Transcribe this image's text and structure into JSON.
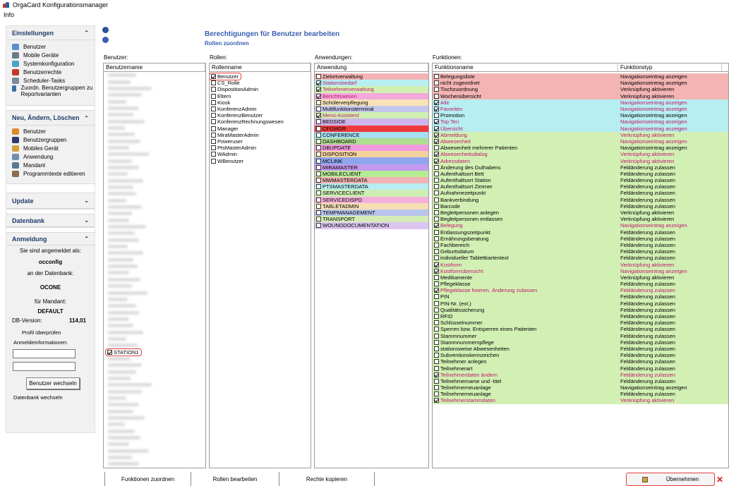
{
  "window": {
    "title": "OrgaCard Konfigurationsmanager",
    "menu": [
      "Info"
    ]
  },
  "sidebar": {
    "einstellungen": {
      "title": "Einstellungen",
      "items": [
        "Benutzer",
        "Mobile Geräte",
        "Systemkonfiguration",
        "Benutzerrechte",
        "Scheduler-Tasks",
        "Zuordn. Benutzergruppen zu Reportvarianten"
      ]
    },
    "neu": {
      "title": "Neu, Ändern, Löschen",
      "items": [
        "Benutzer",
        "Benutzergruppen",
        "Mobiles Gerät",
        "Anwendung",
        "Mandant",
        "Programmtexte editieren"
      ]
    },
    "update": {
      "title": "Update"
    },
    "datenbank": {
      "title": "Datenbank"
    },
    "anmeldung": {
      "title": "Anmeldung",
      "logged_in_as_label": "Sie sind angemeldet als:",
      "user": "occonfig",
      "db_label": "an der Datenbank:",
      "db": "OCONE",
      "mandant_label": "für Mandant:",
      "mandant": "DEFAULT",
      "dbversion_label": "DB-Version:",
      "dbversion": "114,01",
      "profile_check": "Profil überprüfen",
      "login_info_label": "Anmeldeinformationen:",
      "switch_user_btn": "Benutzer wechseln",
      "switch_db": "Datenbank wechseln"
    }
  },
  "main": {
    "heading": "Berechtigungen für Benutzer bearbeiten",
    "subheading": "Rollen zuordnen",
    "users": {
      "label": "Benutzer:",
      "header": "Benutzername",
      "selected": "STATION1"
    },
    "roles": {
      "label": "Rollen:",
      "header": "Rollenname",
      "items": [
        {
          "name": "Benutzer",
          "checked": true
        },
        {
          "name": "CS_Rolle",
          "checked": false
        },
        {
          "name": "DispositionAdmin",
          "checked": false
        },
        {
          "name": "Eltern",
          "checked": false
        },
        {
          "name": "Kiosk",
          "checked": false
        },
        {
          "name": "KonferenzAdmin",
          "checked": false
        },
        {
          "name": "KonferenzBenutzer",
          "checked": false
        },
        {
          "name": "KonferenzRechnungswesen",
          "checked": false
        },
        {
          "name": "Manager",
          "checked": false
        },
        {
          "name": "MiraMasterAdmin",
          "checked": false
        },
        {
          "name": "Poweruser",
          "checked": false
        },
        {
          "name": "PtsMasterAdmin",
          "checked": false
        },
        {
          "name": "WAdmin",
          "checked": false
        },
        {
          "name": "WBenutzer",
          "checked": false
        }
      ]
    },
    "apps": {
      "label": "Anwendungen:",
      "header": "Anwendung",
      "items": [
        {
          "name": "Zielortverwaltung",
          "checked": false,
          "color": "#f4b4b4",
          "text": "#000000"
        },
        {
          "name": "Stationsbedarf",
          "checked": true,
          "color": "#b6eef2",
          "text": "#c0186a"
        },
        {
          "name": "Teilnehmerverwaltung",
          "checked": true,
          "color": "#d2f0b4",
          "text": "#c0186a"
        },
        {
          "name": "Berichtswesen",
          "checked": true,
          "color": "#f5a8dc",
          "text": "#c0186a"
        },
        {
          "name": "Schülerverpflegung",
          "checked": false,
          "color": "#f8e3b8",
          "text": "#000000"
        },
        {
          "name": "Multifunktionsterminal",
          "checked": false,
          "color": "#c3c8ec",
          "text": "#000000"
        },
        {
          "name": "Menü-Assistent",
          "checked": true,
          "color": "#cfeeb0",
          "text": "#c0186a"
        },
        {
          "name": "BEDSIDE",
          "checked": false,
          "color": "#d0b4ec",
          "text": "#000000"
        },
        {
          "name": "CFGMGR",
          "checked": false,
          "color": "#ee3a3a",
          "text": "#000000"
        },
        {
          "name": "CONFERENCE",
          "checked": false,
          "color": "#a6dff0",
          "text": "#000000"
        },
        {
          "name": "DASHBOARD",
          "checked": false,
          "color": "#aedc90",
          "text": "#000000"
        },
        {
          "name": "DBUPDATE",
          "checked": false,
          "color": "#f09be0",
          "text": "#000000"
        },
        {
          "name": "DISPOSITION",
          "checked": false,
          "color": "#f3d39c",
          "text": "#000000"
        },
        {
          "name": "MCLINK",
          "checked": false,
          "color": "#8fa6ee",
          "text": "#000000"
        },
        {
          "name": "MIRAMASTER",
          "checked": false,
          "color": "#c39aee",
          "text": "#000000"
        },
        {
          "name": "MOBILECLIENT",
          "checked": false,
          "color": "#b6ec94",
          "text": "#000000"
        },
        {
          "name": "MWMASTERDATA",
          "checked": false,
          "color": "#f1b3b3",
          "text": "#000000"
        },
        {
          "name": "PTSMASTERDATA",
          "checked": false,
          "color": "#b9edf1",
          "text": "#000000"
        },
        {
          "name": "SERVICECLIENT",
          "checked": false,
          "color": "#cdeeb2",
          "text": "#000000"
        },
        {
          "name": "SERVICEDISPO",
          "checked": false,
          "color": "#f5b0dc",
          "text": "#000000"
        },
        {
          "name": "TABLETADMIN",
          "checked": false,
          "color": "#f7dfb4",
          "text": "#000000"
        },
        {
          "name": "TEMPMANAGEMENT",
          "checked": false,
          "color": "#b9c4ee",
          "text": "#000000"
        },
        {
          "name": "TRANSPORT",
          "checked": false,
          "color": "#d3ecb6",
          "text": "#000000"
        },
        {
          "name": "WOUNDDOCUMENTATION",
          "checked": false,
          "color": "#dcc6f0",
          "text": "#000000"
        }
      ]
    },
    "functions": {
      "label": "Funktionen:",
      "headers": [
        "Funktionsname",
        "Funktionstyp"
      ],
      "items": [
        {
          "name": "Belegungsliste",
          "type": "Navigationseintrag anzeigen",
          "checked": false,
          "color": "#f4b4b4",
          "text": "#000000"
        },
        {
          "name": "nicht zugeordnet",
          "type": "Navigationseintrag anzeigen",
          "checked": false,
          "color": "#f4b4b4",
          "text": "#000000"
        },
        {
          "name": "Tischzuordnung",
          "type": "Verknüpfung aktivieren",
          "checked": false,
          "color": "#f4b4b4",
          "text": "#000000"
        },
        {
          "name": "Wochenübersicht",
          "type": "Verknüpfung aktivieren",
          "checked": false,
          "color": "#f4b4b4",
          "text": "#000000"
        },
        {
          "name": "Alle",
          "type": "Navigationseintrag anzeigen",
          "checked": true,
          "color": "#b6eef2",
          "text": "#c0186a"
        },
        {
          "name": "Favoriten",
          "type": "Navigationseintrag anzeigen",
          "checked": true,
          "color": "#b6eef2",
          "text": "#c0186a"
        },
        {
          "name": "Promotion",
          "type": "Navigationseintrag anzeigen",
          "checked": false,
          "color": "#b6eef2",
          "text": "#000000"
        },
        {
          "name": "Top Ten",
          "type": "Navigationseintrag anzeigen",
          "checked": true,
          "color": "#b6eef2",
          "text": "#c0186a"
        },
        {
          "name": "Übersicht",
          "type": "Navigationseintrag anzeigen",
          "checked": true,
          "color": "#b6eef2",
          "text": "#c0186a"
        },
        {
          "name": "Abmeldung",
          "type": "Verknüpfung aktivieren",
          "checked": true,
          "color": "#d2f0b4",
          "text": "#c0186a"
        },
        {
          "name": "Abwesenheit",
          "type": "Navigationseintrag anzeigen",
          "checked": true,
          "color": "#d2f0b4",
          "text": "#c0186a"
        },
        {
          "name": "Abwesenheit mehrerer Patienten",
          "type": "Navigationseintrag anzeigen",
          "checked": false,
          "color": "#d2f0b4",
          "text": "#000000"
        },
        {
          "name": "Abwesenheitsdialog",
          "type": "Verknüpfung aktivieren",
          "checked": true,
          "color": "#d2f0b4",
          "text": "#c0186a"
        },
        {
          "name": "Adressdaten",
          "type": "Verknüpfung aktivieren",
          "checked": true,
          "color": "#d2f0b4",
          "text": "#c0186a"
        },
        {
          "name": "Änderung des Guthabens",
          "type": "Feldänderung zulassen",
          "checked": false,
          "color": "#d2f0b4",
          "text": "#000000"
        },
        {
          "name": "Aufenthaltsort Bett",
          "type": "Feldänderung zulassen",
          "checked": false,
          "color": "#d2f0b4",
          "text": "#000000"
        },
        {
          "name": "Aufenthaltsort Station",
          "type": "Feldänderung zulassen",
          "checked": false,
          "color": "#d2f0b4",
          "text": "#000000"
        },
        {
          "name": "Aufenthaltsort Zimmer",
          "type": "Feldänderung zulassen",
          "checked": false,
          "color": "#d2f0b4",
          "text": "#000000"
        },
        {
          "name": "Aufnahmezeitpunkt",
          "type": "Feldänderung zulassen",
          "checked": false,
          "color": "#d2f0b4",
          "text": "#000000"
        },
        {
          "name": "Bankverbindung",
          "type": "Feldänderung zulassen",
          "checked": false,
          "color": "#d2f0b4",
          "text": "#000000"
        },
        {
          "name": "Barcode",
          "type": "Feldänderung zulassen",
          "checked": false,
          "color": "#d2f0b4",
          "text": "#000000"
        },
        {
          "name": "Begleitpersonen anlegen",
          "type": "Verknüpfung aktivieren",
          "checked": false,
          "color": "#d2f0b4",
          "text": "#000000"
        },
        {
          "name": "Begleitpersonen entlassen",
          "type": "Verknüpfung aktivieren",
          "checked": false,
          "color": "#d2f0b4",
          "text": "#000000"
        },
        {
          "name": "Belegung",
          "type": "Navigationseintrag anzeigen",
          "checked": true,
          "color": "#d2f0b4",
          "text": "#c0186a"
        },
        {
          "name": "Entlassungszeitpunkt",
          "type": "Feldänderung zulassen",
          "checked": false,
          "color": "#d2f0b4",
          "text": "#000000"
        },
        {
          "name": "Ernährungsberatung",
          "type": "Feldänderung zulassen",
          "checked": false,
          "color": "#d2f0b4",
          "text": "#000000"
        },
        {
          "name": "Fachbereich",
          "type": "Feldänderung zulassen",
          "checked": false,
          "color": "#d2f0b4",
          "text": "#000000"
        },
        {
          "name": "Geburtsdatum",
          "type": "Feldänderung zulassen",
          "checked": false,
          "color": "#d2f0b4",
          "text": "#000000"
        },
        {
          "name": "individueller Tablettkartentext",
          "type": "Feldänderung zulassen",
          "checked": false,
          "color": "#d2f0b4",
          "text": "#000000"
        },
        {
          "name": "Kostform",
          "type": "Verknüpfung aktivieren",
          "checked": true,
          "color": "#d2f0b4",
          "text": "#c0186a"
        },
        {
          "name": "Kostformübersicht",
          "type": "Navigationseintrag anzeigen",
          "checked": true,
          "color": "#d2f0b4",
          "text": "#c0186a"
        },
        {
          "name": "Medikamente",
          "type": "Verknüpfung aktivieren",
          "checked": false,
          "color": "#d2f0b4",
          "text": "#000000"
        },
        {
          "name": "Pflegeklasse",
          "type": "Feldänderung zulassen",
          "checked": false,
          "color": "#d2f0b4",
          "text": "#000000"
        },
        {
          "name": "Pflegeklasse fixieren, Änderung zulassen",
          "type": "Feldänderung zulassen",
          "checked": true,
          "color": "#d2f0b4",
          "text": "#c0186a"
        },
        {
          "name": "PIN",
          "type": "Feldänderung zulassen",
          "checked": false,
          "color": "#d2f0b4",
          "text": "#000000"
        },
        {
          "name": "PIN-Nr. (ext.)",
          "type": "Feldänderung zulassen",
          "checked": false,
          "color": "#d2f0b4",
          "text": "#000000"
        },
        {
          "name": "Qualitätssicherung",
          "type": "Feldänderung zulassen",
          "checked": false,
          "color": "#d2f0b4",
          "text": "#000000"
        },
        {
          "name": "RFID",
          "type": "Feldänderung zulassen",
          "checked": false,
          "color": "#d2f0b4",
          "text": "#000000"
        },
        {
          "name": "Schlüsselnummer",
          "type": "Feldänderung zulassen",
          "checked": false,
          "color": "#d2f0b4",
          "text": "#000000"
        },
        {
          "name": "Sperren bzw. Entsperren eines Patienten",
          "type": "Feldänderung zulassen",
          "checked": false,
          "color": "#d2f0b4",
          "text": "#000000"
        },
        {
          "name": "Stammnummer",
          "type": "Feldänderung zulassen",
          "checked": false,
          "color": "#d2f0b4",
          "text": "#000000"
        },
        {
          "name": "Stammnummernpflege",
          "type": "Feldänderung zulassen",
          "checked": false,
          "color": "#d2f0b4",
          "text": "#000000"
        },
        {
          "name": "stationsweise Abwesenheiten",
          "type": "Feldänderung zulassen",
          "checked": false,
          "color": "#d2f0b4",
          "text": "#000000"
        },
        {
          "name": "Subventionskennzeichen",
          "type": "Feldänderung zulassen",
          "checked": false,
          "color": "#d2f0b4",
          "text": "#000000"
        },
        {
          "name": "Teilnehmer anlegen",
          "type": "Feldänderung zulassen",
          "checked": false,
          "color": "#d2f0b4",
          "text": "#000000"
        },
        {
          "name": "Teilnehmerart",
          "type": "Feldänderung zulassen",
          "checked": false,
          "color": "#d2f0b4",
          "text": "#000000"
        },
        {
          "name": "Teilnehmerdaten ändern",
          "type": "Feldänderung zulassen",
          "checked": true,
          "color": "#d2f0b4",
          "text": "#c0186a"
        },
        {
          "name": "Teilnehmername und -titel",
          "type": "Feldänderung zulassen",
          "checked": false,
          "color": "#d2f0b4",
          "text": "#000000"
        },
        {
          "name": "Teilnehmerneuanlage",
          "type": "Navigationseintrag anzeigen",
          "checked": false,
          "color": "#d2f0b4",
          "text": "#000000"
        },
        {
          "name": "Teilnehmerneuanlage",
          "type": "Feldänderung zulassen",
          "checked": false,
          "color": "#d2f0b4",
          "text": "#000000"
        },
        {
          "name": "Teilnehmerstammdaten",
          "type": "Verknüpfung aktivieren",
          "checked": true,
          "color": "#d2f0b4",
          "text": "#c0186a"
        }
      ]
    }
  },
  "bottom": {
    "buttons": [
      "Funktionen zuordnen",
      "Rollen bearbeiten",
      "Rechte kopieren"
    ],
    "apply": "Übernehmen",
    "close": "✕"
  }
}
